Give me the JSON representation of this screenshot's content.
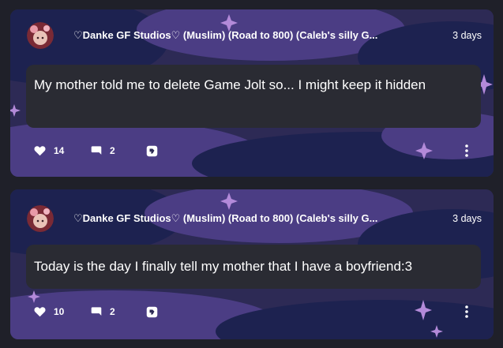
{
  "posts": [
    {
      "author": "♡Danke GF Studios♡ (Muslim) (Road to 800) (Caleb's silly G...",
      "time": "3 days",
      "text": "My mother told me to delete Game Jolt so... I might keep it hidden",
      "likes": "14",
      "comments": "2"
    },
    {
      "author": "♡Danke GF Studios♡ (Muslim) (Road to 800) (Caleb's silly G...",
      "time": "3 days",
      "text": "Today is the day I finally tell my mother that I have a boyfriend:3",
      "likes": "10",
      "comments": "2"
    }
  ],
  "colors": {
    "page_bg": "#1f2029",
    "card_bg": "#2d2a55",
    "cloud_dark": "#1d2250",
    "cloud_light": "#4b3d84",
    "bubble_bg": "#2a2b33",
    "sparkle": "#b38ad9"
  },
  "icons": [
    "avatar",
    "heart-icon",
    "comment-icon",
    "share-icon",
    "more-icon",
    "sparkle-icon"
  ]
}
